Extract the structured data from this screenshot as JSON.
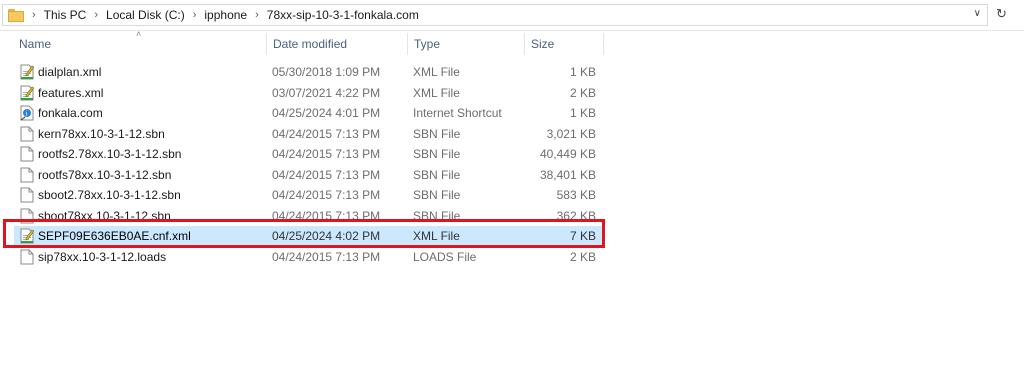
{
  "breadcrumb": [
    "This PC",
    "Local Disk (C:)",
    "ipphone",
    "78xx-sip-10-3-1-fonkala.com"
  ],
  "columns": {
    "name": "Name",
    "date": "Date modified",
    "type": "Type",
    "size": "Size"
  },
  "files": [
    {
      "name": "dialplan.xml",
      "date": "05/30/2018 1:09 PM",
      "type": "XML File",
      "size": "1 KB",
      "icon": "xml-file-icon"
    },
    {
      "name": "features.xml",
      "date": "03/07/2021 4:22 PM",
      "type": "XML File",
      "size": "2 KB",
      "icon": "xml-file-icon"
    },
    {
      "name": "fonkala.com",
      "date": "04/25/2024 4:01 PM",
      "type": "Internet Shortcut",
      "size": "1 KB",
      "icon": "internet-shortcut-icon"
    },
    {
      "name": "kern78xx.10-3-1-12.sbn",
      "date": "04/24/2015 7:13 PM",
      "type": "SBN File",
      "size": "3,021 KB",
      "icon": "blank-file-icon"
    },
    {
      "name": "rootfs2.78xx.10-3-1-12.sbn",
      "date": "04/24/2015 7:13 PM",
      "type": "SBN File",
      "size": "40,449 KB",
      "icon": "blank-file-icon"
    },
    {
      "name": "rootfs78xx.10-3-1-12.sbn",
      "date": "04/24/2015 7:13 PM",
      "type": "SBN File",
      "size": "38,401 KB",
      "icon": "blank-file-icon"
    },
    {
      "name": "sboot2.78xx.10-3-1-12.sbn",
      "date": "04/24/2015 7:13 PM",
      "type": "SBN File",
      "size": "583 KB",
      "icon": "blank-file-icon"
    },
    {
      "name": "sboot78xx.10-3-1-12.sbn",
      "date": "04/24/2015 7:13 PM",
      "type": "SBN File",
      "size": "362 KB",
      "icon": "blank-file-icon"
    },
    {
      "name": "SEPF09E636EB0AE.cnf.xml",
      "date": "04/25/2024 4:02 PM",
      "type": "XML File",
      "size": "7 KB",
      "icon": "xml-file-icon",
      "selected": true
    },
    {
      "name": "sip78xx.10-3-1-12.loads",
      "date": "04/24/2015 7:13 PM",
      "type": "LOADS File",
      "size": "2 KB",
      "icon": "blank-file-icon"
    }
  ],
  "colors": {
    "selection": "#cce8ff",
    "highlight_border": "#e0141e",
    "header_text": "#4c607a"
  }
}
